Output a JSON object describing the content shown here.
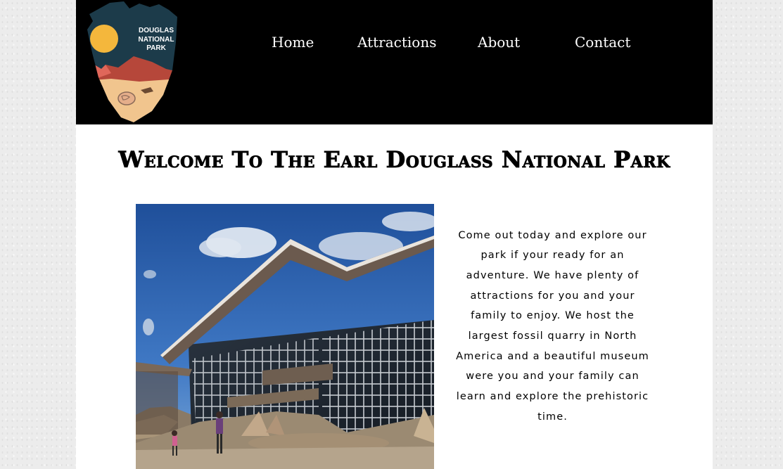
{
  "header": {
    "logo": {
      "line1": "DOUGLAS",
      "line2": "NATIONAL",
      "line3": "PARK",
      "colors": {
        "badge": "#1c3b4a",
        "sun": "#f4b73c",
        "mountain": "#b6473a",
        "peak_light": "#e0675a",
        "ground": "#f1c58e"
      }
    },
    "nav": [
      {
        "label": "Home"
      },
      {
        "label": "Attractions"
      },
      {
        "label": "About"
      },
      {
        "label": "Contact"
      }
    ]
  },
  "main": {
    "title": "Welcome To The Earl Douglass National Park",
    "intro": "Come out today and explore our park if your ready for an adventure. We have plenty of attractions for you and your family to enjoy. We host the largest fossil quarry in North America and a beautiful museum were you and your family can learn and explore the prehistoric time.",
    "photo": {
      "icon": "quarry-exhibit-hall-photo"
    }
  }
}
